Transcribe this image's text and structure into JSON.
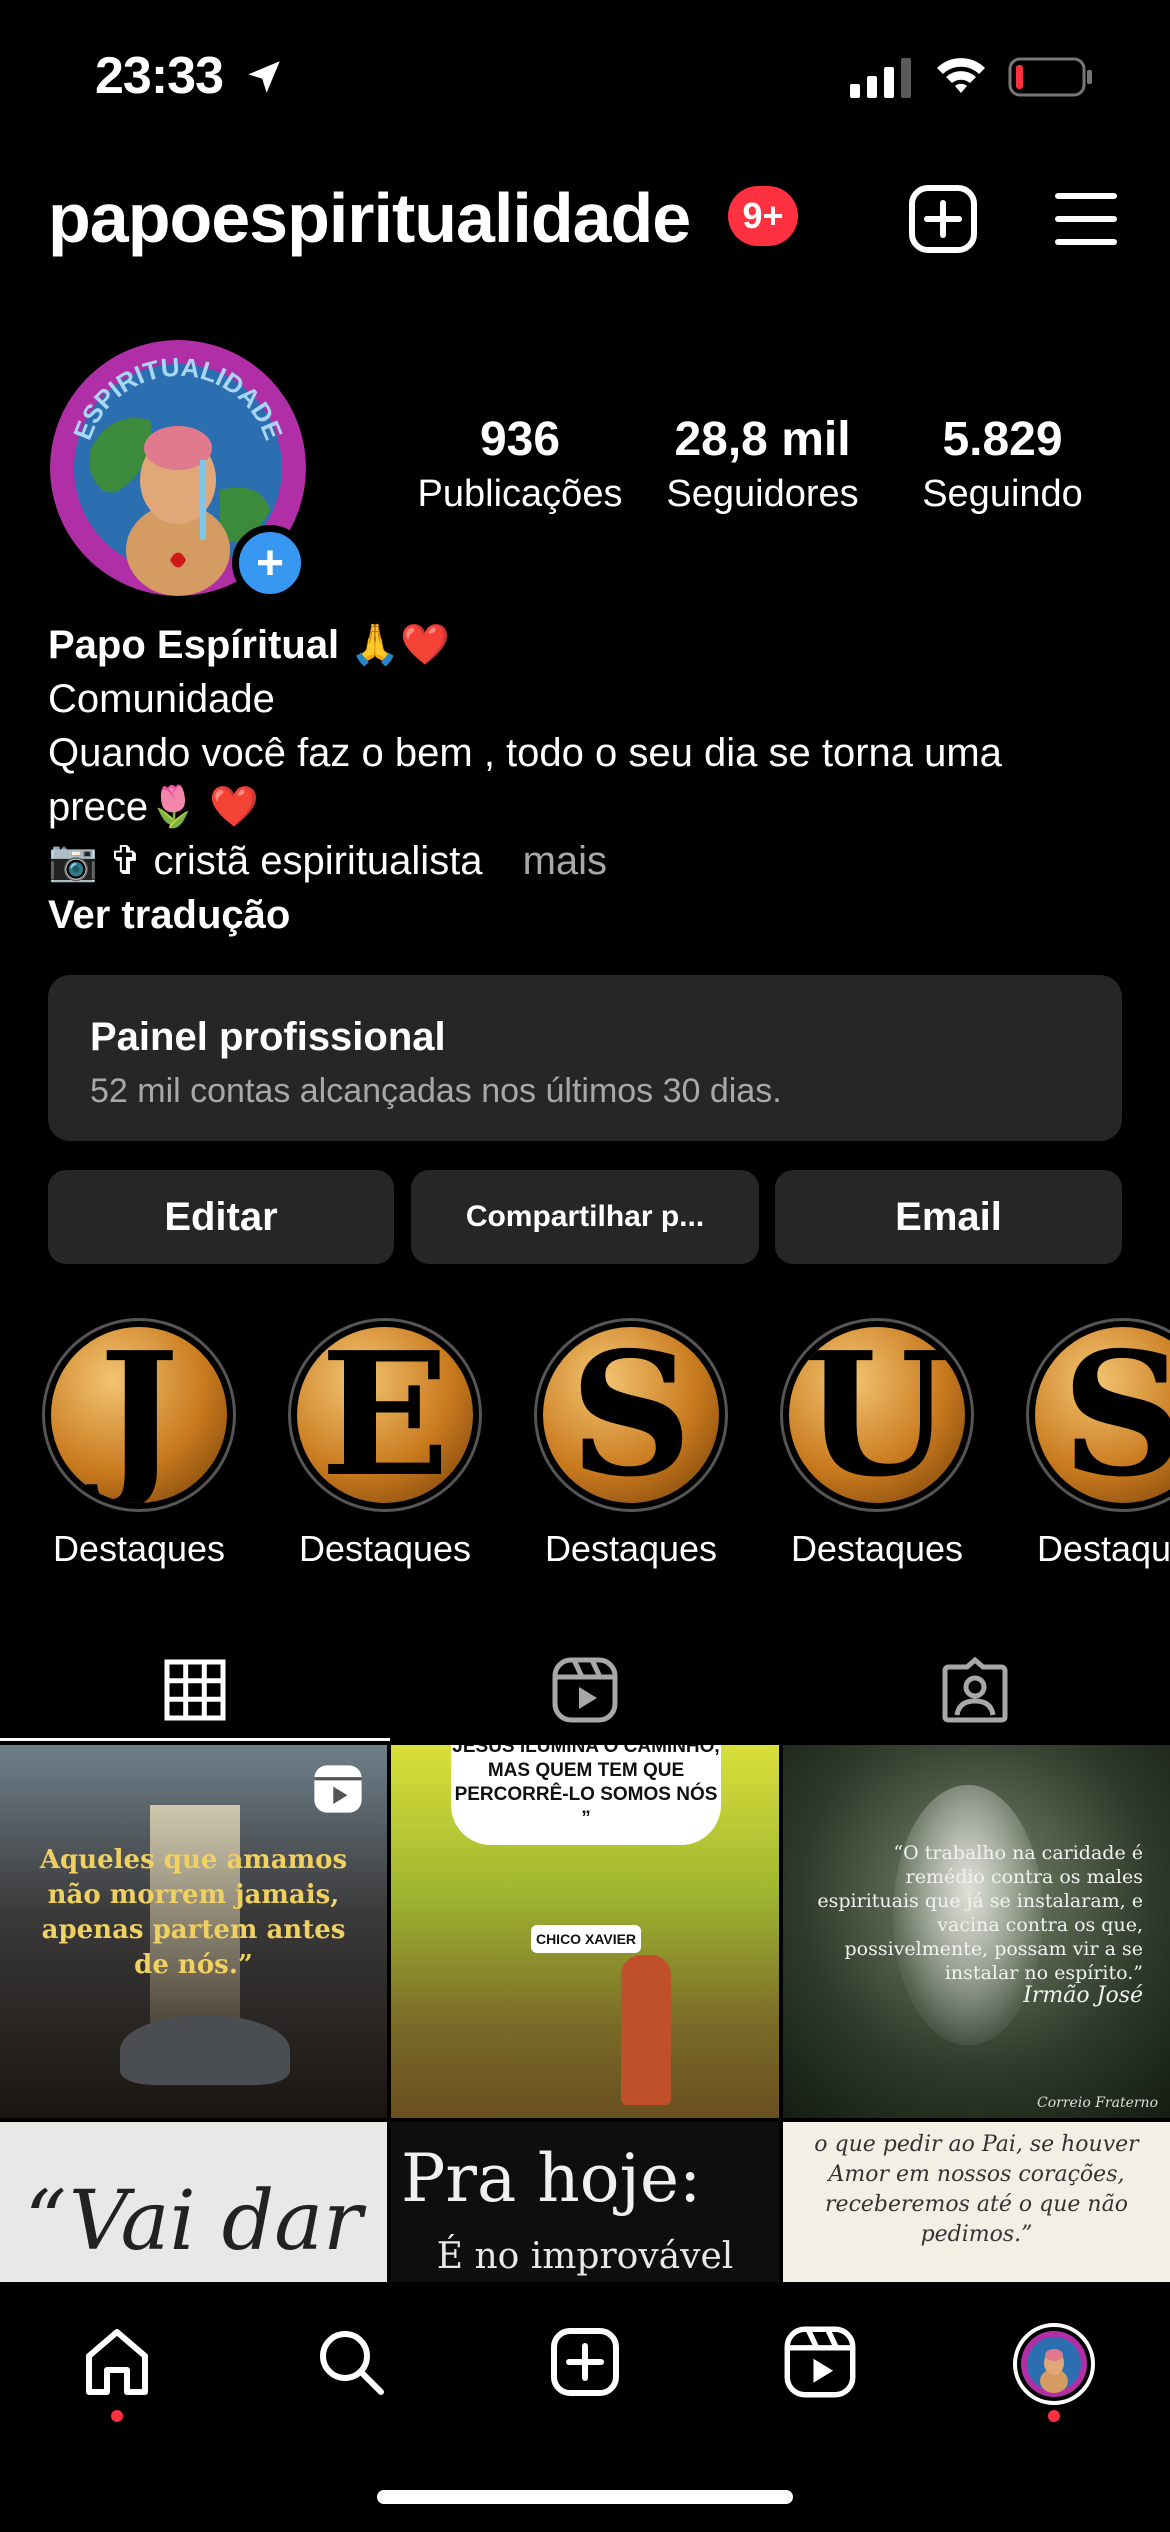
{
  "status_bar": {
    "time": "23:33"
  },
  "header": {
    "username": "papoespiritualidade",
    "notification_badge": "9+"
  },
  "profile": {
    "stats": [
      {
        "value": "936",
        "label": "Publicações"
      },
      {
        "value": "28,8 mil",
        "label": "Seguidores"
      },
      {
        "value": "5.829",
        "label": "Seguindo"
      }
    ],
    "avatar_text": "ESPIRITUALIDADE",
    "name": "Papo Espíritual 🙏❤️",
    "category": "Comunidade",
    "bio_line1": "Quando você faz o bem , todo o seu dia se torna uma",
    "bio_line2": "prece🌷 ❤️",
    "bio_line3": "📷 ✞ cristã espiritualista",
    "more_label": "mais",
    "translate_label": "Ver tradução"
  },
  "professional_dashboard": {
    "title": "Painel profissional",
    "subtitle": "52 mil contas alcançadas nos últimos 30 dias."
  },
  "actions": {
    "edit": "Editar",
    "share": "Compartilhar p...",
    "email": "Email"
  },
  "highlights": [
    {
      "letter": "J",
      "label": "Destaques"
    },
    {
      "letter": "E",
      "label": "Destaques"
    },
    {
      "letter": "S",
      "label": "Destaques"
    },
    {
      "letter": "U",
      "label": "Destaques"
    },
    {
      "letter": "S",
      "label": "Destaques"
    }
  ],
  "posts": {
    "p1": "Aqueles que amamos não morrem jamais, apenas partem antes de nós.”",
    "p2_top": "JESUS ILUMINA O CAMINHO, MAS QUEM TEM QUE PERCORRÊ-LO SOMOS NÓS ”",
    "p2_author": "CHICO XAVIER",
    "p3_quote": "“O trabalho na caridade é remédio contra os males espirituais que já se instalaram, e vacina contra os que, possivelmente, possam vir a se instalar no espírito.”",
    "p3_author": "Irmão José",
    "p3_source": "Correio Fraterno",
    "p4": "“Vai dar",
    "p5_title": "Pra hoje:",
    "p5_sub": "É no improvável",
    "p6": "o que pedir ao Pai, se houver Amor em nossos corações, receberemos até o que não pedimos.”"
  },
  "colors": {
    "accent": "#3897f0",
    "badge": "#ff3040",
    "panel": "#262626"
  }
}
